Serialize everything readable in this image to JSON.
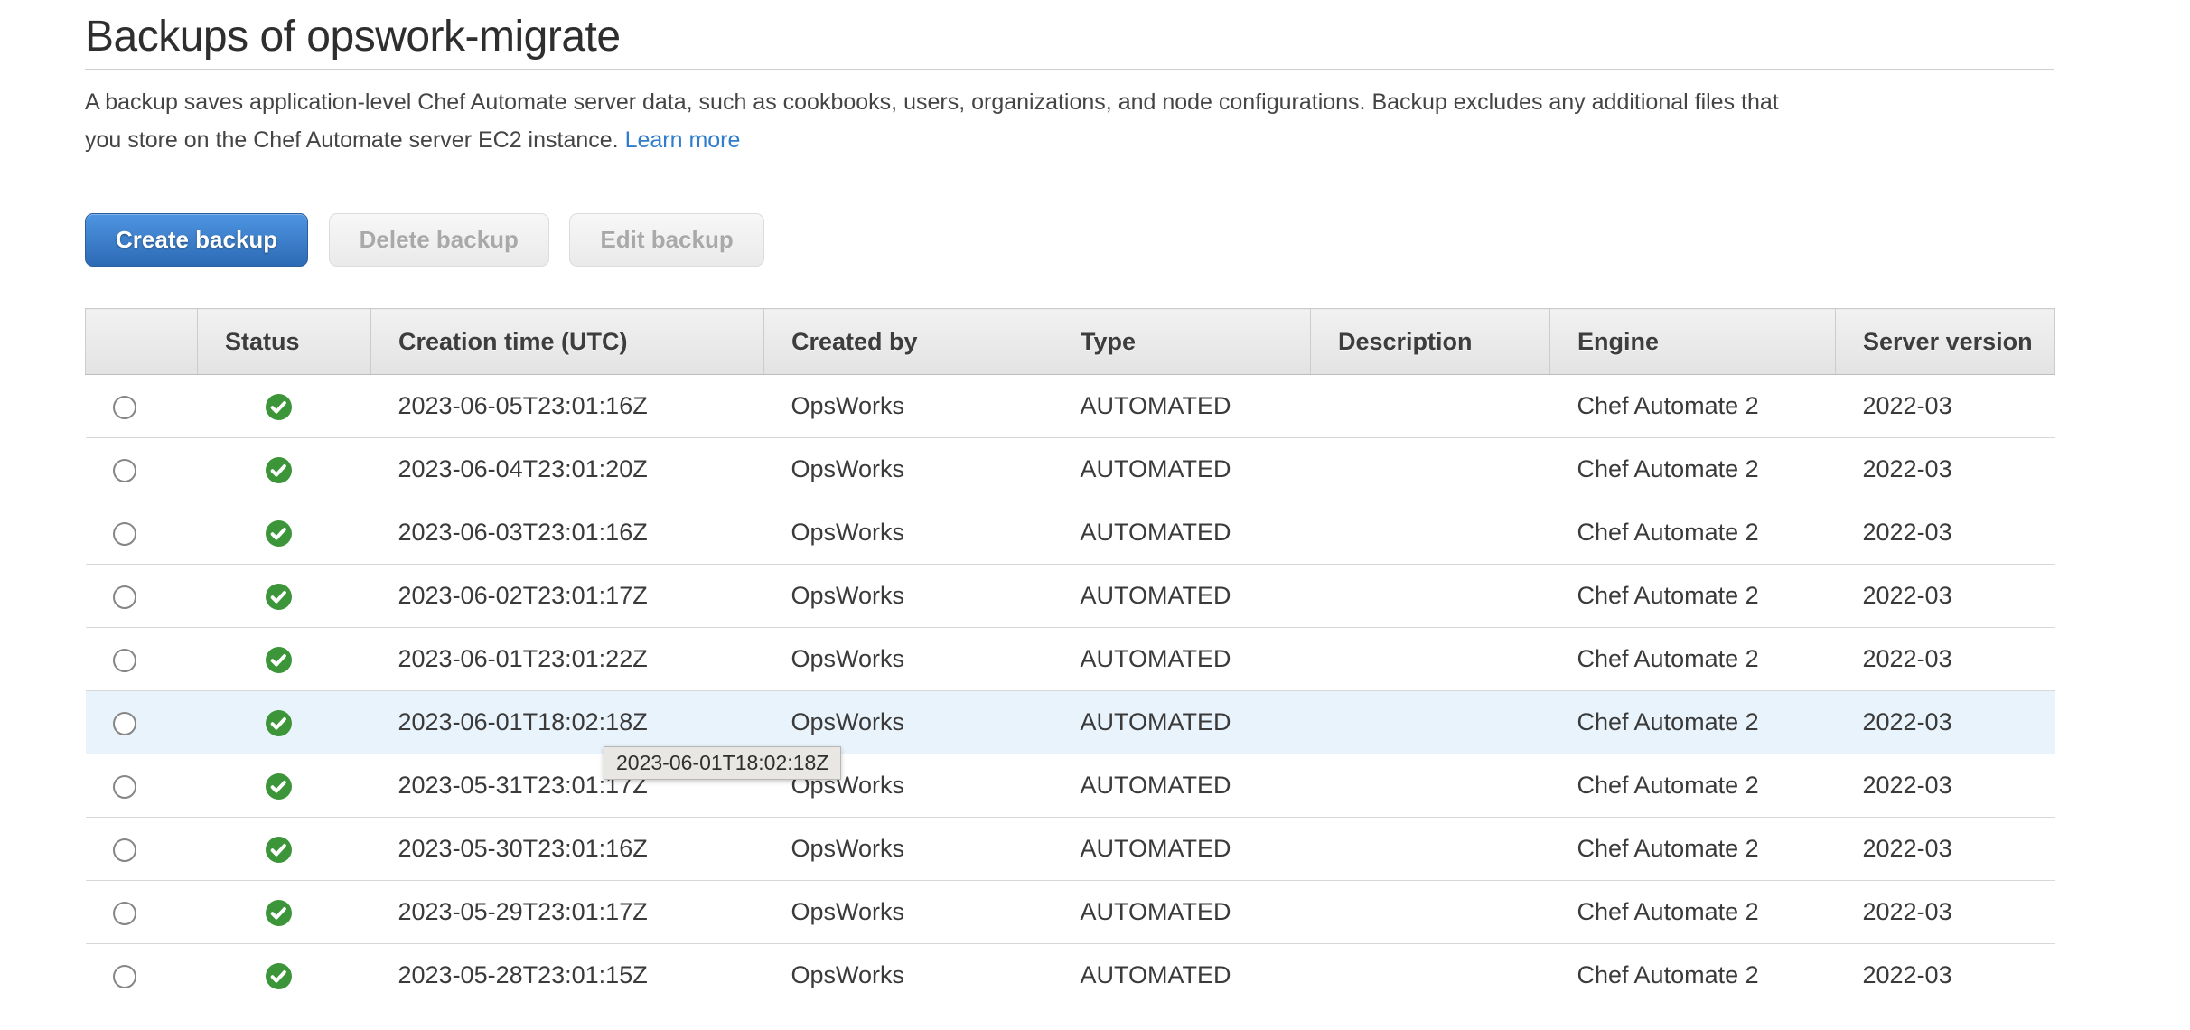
{
  "page": {
    "title": "Backups of opswork-migrate",
    "description_lines": [
      "A backup saves application-level Chef Automate server data, such as cookbooks, users, organizations, and node configurations. Backup excludes any additional files that",
      "you store on the Chef Automate server EC2 instance."
    ],
    "learn_more_label": "Learn more"
  },
  "toolbar": {
    "create_label": "Create backup",
    "delete_label": "Delete backup",
    "edit_label": "Edit backup"
  },
  "table": {
    "columns": [
      "",
      "Status",
      "Creation time (UTC)",
      "Created by",
      "Type",
      "Description",
      "Engine",
      "Server version"
    ],
    "rows": [
      {
        "status": "success",
        "status_icon": "check-circle-icon",
        "creation_time": "2023-06-05T23:01:16Z",
        "created_by": "OpsWorks",
        "type": "AUTOMATED",
        "description": "",
        "engine": "Chef Automate 2",
        "server_version": "2022-03",
        "highlighted": false
      },
      {
        "status": "success",
        "status_icon": "check-circle-icon",
        "creation_time": "2023-06-04T23:01:20Z",
        "created_by": "OpsWorks",
        "type": "AUTOMATED",
        "description": "",
        "engine": "Chef Automate 2",
        "server_version": "2022-03",
        "highlighted": false
      },
      {
        "status": "success",
        "status_icon": "check-circle-icon",
        "creation_time": "2023-06-03T23:01:16Z",
        "created_by": "OpsWorks",
        "type": "AUTOMATED",
        "description": "",
        "engine": "Chef Automate 2",
        "server_version": "2022-03",
        "highlighted": false
      },
      {
        "status": "success",
        "status_icon": "check-circle-icon",
        "creation_time": "2023-06-02T23:01:17Z",
        "created_by": "OpsWorks",
        "type": "AUTOMATED",
        "description": "",
        "engine": "Chef Automate 2",
        "server_version": "2022-03",
        "highlighted": false
      },
      {
        "status": "success",
        "status_icon": "check-circle-icon",
        "creation_time": "2023-06-01T23:01:22Z",
        "created_by": "OpsWorks",
        "type": "AUTOMATED",
        "description": "",
        "engine": "Chef Automate 2",
        "server_version": "2022-03",
        "highlighted": false
      },
      {
        "status": "success",
        "status_icon": "check-circle-icon",
        "creation_time": "2023-06-01T18:02:18Z",
        "created_by": "OpsWorks",
        "type": "AUTOMATED",
        "description": "",
        "engine": "Chef Automate 2",
        "server_version": "2022-03",
        "highlighted": true
      },
      {
        "status": "success",
        "status_icon": "check-circle-icon",
        "creation_time": "2023-05-31T23:01:17Z",
        "created_by": "OpsWorks",
        "type": "AUTOMATED",
        "description": "",
        "engine": "Chef Automate 2",
        "server_version": "2022-03",
        "highlighted": false
      },
      {
        "status": "success",
        "status_icon": "check-circle-icon",
        "creation_time": "2023-05-30T23:01:16Z",
        "created_by": "OpsWorks",
        "type": "AUTOMATED",
        "description": "",
        "engine": "Chef Automate 2",
        "server_version": "2022-03",
        "highlighted": false
      },
      {
        "status": "success",
        "status_icon": "check-circle-icon",
        "creation_time": "2023-05-29T23:01:17Z",
        "created_by": "OpsWorks",
        "type": "AUTOMATED",
        "description": "",
        "engine": "Chef Automate 2",
        "server_version": "2022-03",
        "highlighted": false
      },
      {
        "status": "success",
        "status_icon": "check-circle-icon",
        "creation_time": "2023-05-28T23:01:15Z",
        "created_by": "OpsWorks",
        "type": "AUTOMATED",
        "description": "",
        "engine": "Chef Automate 2",
        "server_version": "2022-03",
        "highlighted": false
      }
    ]
  },
  "tooltip": {
    "text": "2023-06-01T18:02:18Z"
  },
  "colors": {
    "primary_button_blue": "#3479c2",
    "link_blue": "#2f7dcc",
    "success_green": "#3c9639",
    "selected_row_blue": "#e9f3fb"
  }
}
